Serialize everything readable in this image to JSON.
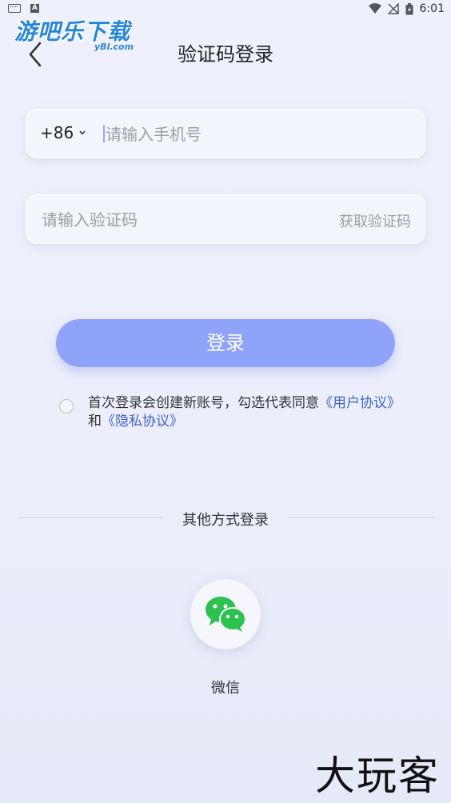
{
  "status_bar": {
    "time": "6:01",
    "icons": [
      "keyboard-icon",
      "a-icon",
      "wifi-icon",
      "signal-off-icon",
      "battery-icon"
    ]
  },
  "watermark": {
    "title": "游吧乐下载",
    "sub": "yBl.com"
  },
  "header": {
    "title": "验证码登录"
  },
  "phone": {
    "country_code": "+86",
    "placeholder": "请输入手机号",
    "value": ""
  },
  "code": {
    "placeholder": "请输入验证码",
    "value": "",
    "get_code_label": "获取验证码"
  },
  "login": {
    "label": "登录"
  },
  "agreement": {
    "checked": false,
    "text": "首次登录会创建新账号，勾选代表同意",
    "user_agreement": "《用户协议》",
    "and": "和",
    "privacy": "《隐私协议》"
  },
  "other": {
    "label": "其他方式登录",
    "wechat_label": "微信"
  },
  "brand_mark": "大玩客",
  "colors": {
    "accent": "#8ea3f9",
    "link": "#3f63c8",
    "wechat": "#2dc24f"
  }
}
